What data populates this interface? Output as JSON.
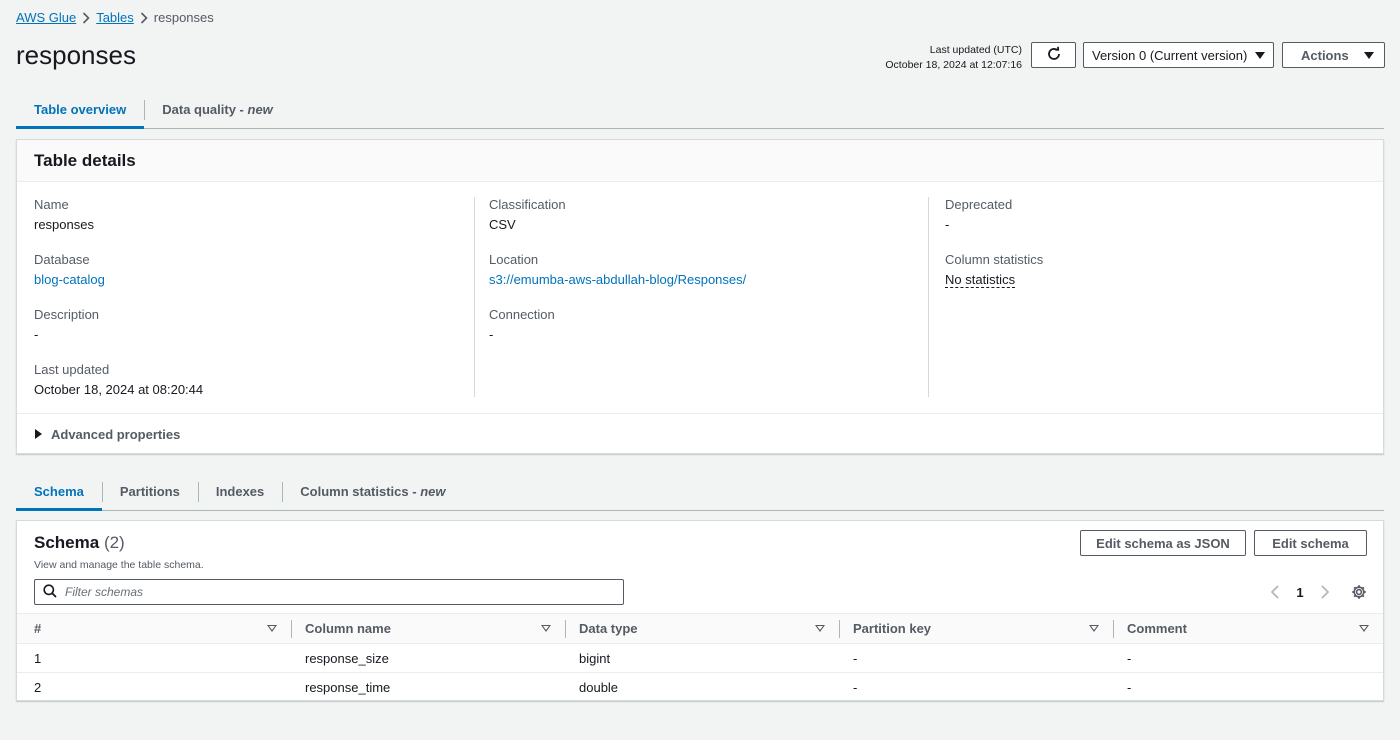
{
  "breadcrumb": {
    "service": "AWS Glue",
    "tables": "Tables",
    "current": "responses"
  },
  "header": {
    "title": "responses",
    "updated_label": "Last updated (UTC)",
    "updated_value": "October 18, 2024 at 12:07:16",
    "version_label": "Version 0 (Current version)",
    "actions_label": "Actions"
  },
  "top_tabs": [
    {
      "label": "Table overview",
      "suffix": ""
    },
    {
      "label": "Data quality - ",
      "suffix": "new"
    }
  ],
  "details": {
    "title": "Table details",
    "col1": [
      {
        "label": "Name",
        "value": "responses"
      },
      {
        "label": "Database",
        "value": "blog-catalog"
      },
      {
        "label": "Description",
        "value": "-"
      },
      {
        "label": "Last updated",
        "value": "October 18, 2024 at 08:20:44"
      }
    ],
    "col2": [
      {
        "label": "Classification",
        "value": "CSV"
      },
      {
        "label": "Location",
        "value": "s3://emumba-aws-abdullah-blog/Responses/"
      },
      {
        "label": "Connection",
        "value": "-"
      }
    ],
    "col3": [
      {
        "label": "Deprecated",
        "value": "-"
      },
      {
        "label": "Column statistics",
        "value": "No statistics"
      }
    ],
    "advanced_label": "Advanced properties"
  },
  "bottom_tabs": [
    {
      "label": "Schema",
      "suffix": ""
    },
    {
      "label": "Partitions",
      "suffix": ""
    },
    {
      "label": "Indexes",
      "suffix": ""
    },
    {
      "label": "Column statistics - ",
      "suffix": "new"
    }
  ],
  "schema": {
    "title": "Schema",
    "count": "(2)",
    "description": "View and manage the table schema.",
    "edit_json_label": "Edit schema as JSON",
    "edit_label": "Edit schema",
    "filter_placeholder": "Filter schemas",
    "page": "1",
    "columns": [
      "#",
      "Column name",
      "Data type",
      "Partition key",
      "Comment"
    ],
    "rows": [
      [
        "1",
        "response_size",
        "bigint",
        "-",
        "-"
      ],
      [
        "2",
        "response_time",
        "double",
        "-",
        "-"
      ]
    ]
  },
  "colors": {
    "link": "#0073bb",
    "border": "#d5dbdb",
    "background": "#f2f3f3",
    "text": "#16191f",
    "muted": "#545b64"
  }
}
